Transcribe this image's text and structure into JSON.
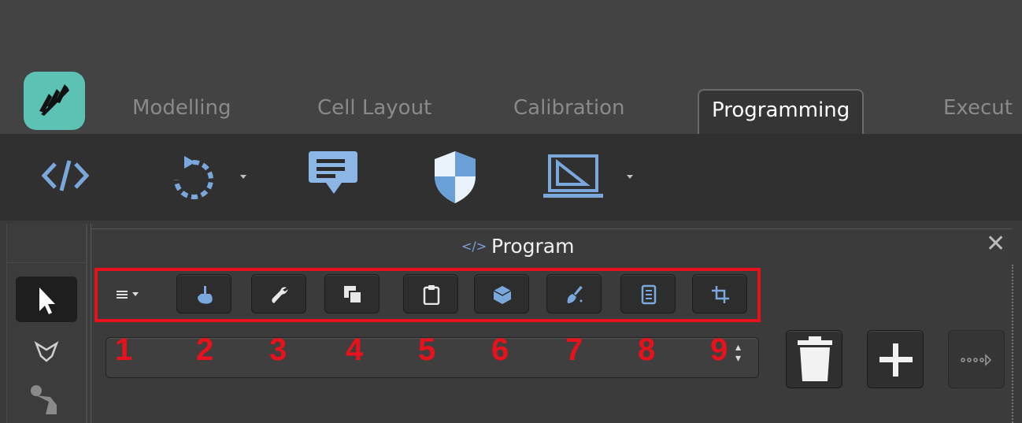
{
  "tabs": [
    {
      "label": "Modelling",
      "active": false
    },
    {
      "label": "Cell Layout",
      "active": false
    },
    {
      "label": "Calibration",
      "active": false
    },
    {
      "label": "Programming",
      "active": true
    },
    {
      "label": "Execut",
      "active": false
    }
  ],
  "toolbar": {
    "items": [
      "code-icon",
      "refresh-cycle-icon",
      "comment-icon",
      "shield-icon",
      "tool-frame-icon"
    ]
  },
  "panel": {
    "title": "Program",
    "close_glyph": "✕"
  },
  "program_toolbar": {
    "buttons": [
      "hand-icon",
      "wrench-icon",
      "copy-icon",
      "clipboard-icon",
      "cube-icon",
      "sweep-icon",
      "list-icon",
      "crop-icon"
    ]
  },
  "annotations": [
    "1",
    "2",
    "3",
    "4",
    "5",
    "6",
    "7",
    "8",
    "9"
  ],
  "colors": {
    "accent_blue": "#6a9fd8",
    "annotation_red": "#e8121c",
    "logo_teal": "#5cc2b4"
  }
}
